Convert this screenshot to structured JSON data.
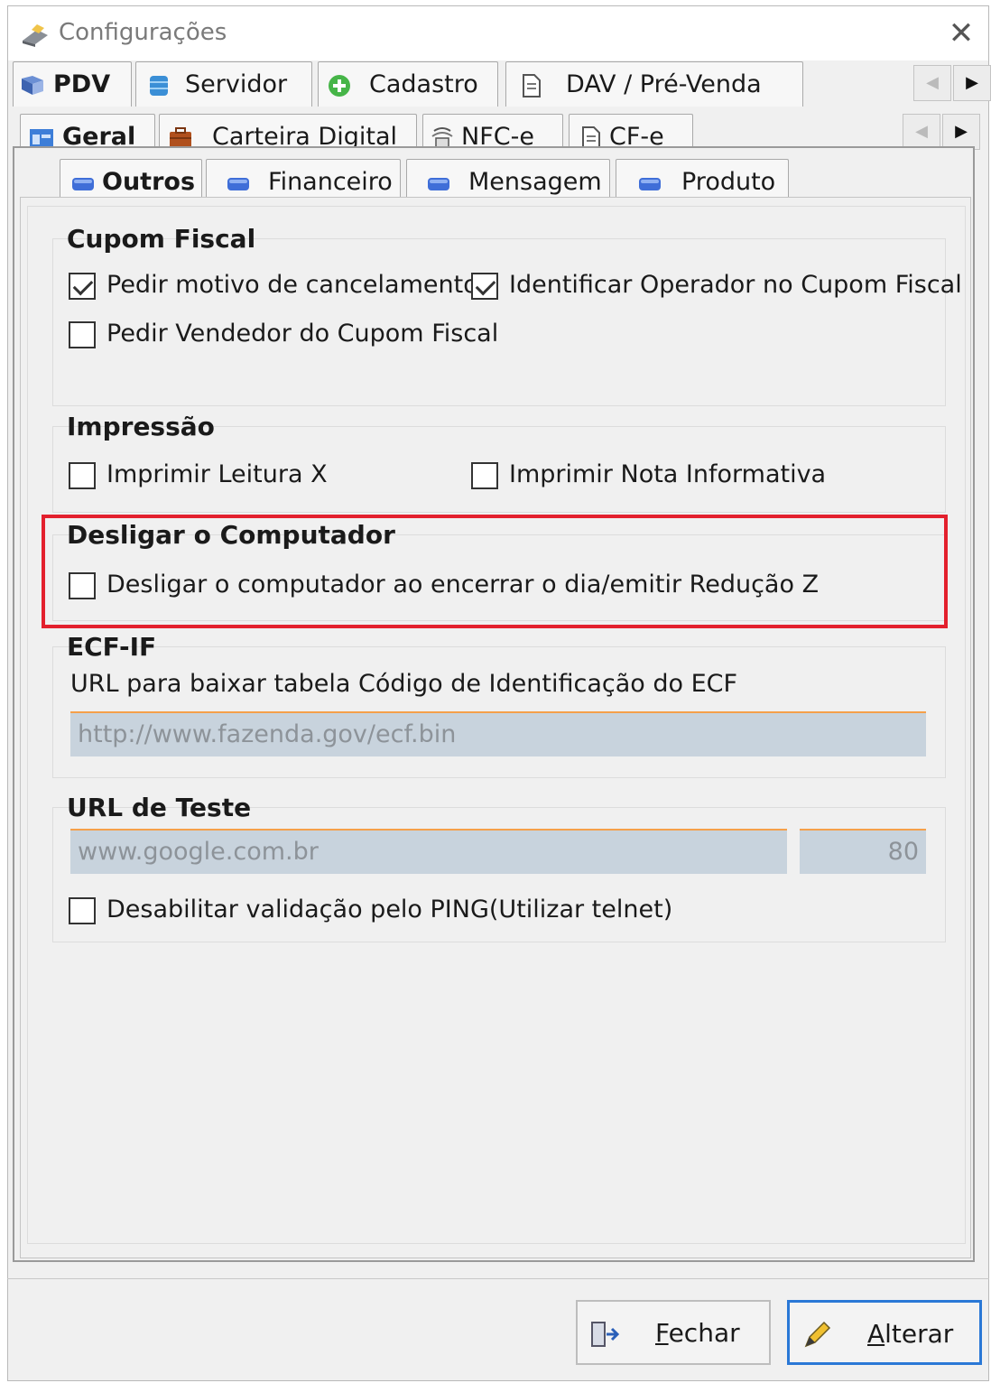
{
  "window": {
    "title": "Configurações"
  },
  "tabs_row1": [
    {
      "label": "PDV",
      "icon": "pdv-icon"
    },
    {
      "label": "Servidor",
      "icon": "database-icon"
    },
    {
      "label": "Cadastro",
      "icon": "add-circle-icon"
    },
    {
      "label": "DAV / Pré-Venda",
      "icon": "document-icon"
    }
  ],
  "tabs_row2": [
    {
      "label": "Geral",
      "icon": "window-icon"
    },
    {
      "label": "Carteira Digital",
      "icon": "wallet-icon"
    },
    {
      "label": "NFC-e",
      "icon": "nfce-icon"
    },
    {
      "label": "CF-e",
      "icon": "document-icon"
    }
  ],
  "tabs_row3": [
    {
      "label": "Outros",
      "icon": "blue-tab-icon"
    },
    {
      "label": "Financeiro",
      "icon": "blue-tab-icon"
    },
    {
      "label": "Mensagem",
      "icon": "blue-tab-icon"
    },
    {
      "label": "Produto",
      "icon": "blue-tab-icon"
    }
  ],
  "groups": {
    "cupom_fiscal": {
      "title": "Cupom Fiscal",
      "pedir_motivo": {
        "label": "Pedir motivo de cancelamento",
        "checked": true
      },
      "identificar_operador": {
        "label": "Identificar Operador no Cupom Fiscal",
        "checked": true
      },
      "pedir_vendedor": {
        "label": "Pedir Vendedor do Cupom Fiscal",
        "checked": false
      }
    },
    "impressao": {
      "title": "Impressão",
      "leitura_x": {
        "label": "Imprimir Leitura X",
        "checked": false
      },
      "nota_informativa": {
        "label": "Imprimir Nota Informativa",
        "checked": false
      }
    },
    "desligar": {
      "title": "Desligar o Computador",
      "desligar_ao_encerrar": {
        "label": "Desligar o computador ao encerrar o dia/emitir Redução Z",
        "checked": false
      }
    },
    "ecf": {
      "title": "ECF-IF",
      "url_label": "URL para baixar tabela Código de Identificação do ECF",
      "url_value": "http://www.fazenda.gov/ecf.bin"
    },
    "url_teste": {
      "title": "URL de Teste",
      "url_value": "www.google.com.br",
      "port_value": "80",
      "desabilitar_ping": {
        "label": "Desabilitar validação pelo PING(Utilizar telnet)",
        "checked": false
      }
    }
  },
  "buttons": {
    "fechar": "Fechar",
    "alterar": "Alterar"
  },
  "colors": {
    "highlight": "#e3202d",
    "field_bg": "#c8d3dd",
    "field_border": "#f5a04a",
    "primary_border": "#2a78d6"
  }
}
